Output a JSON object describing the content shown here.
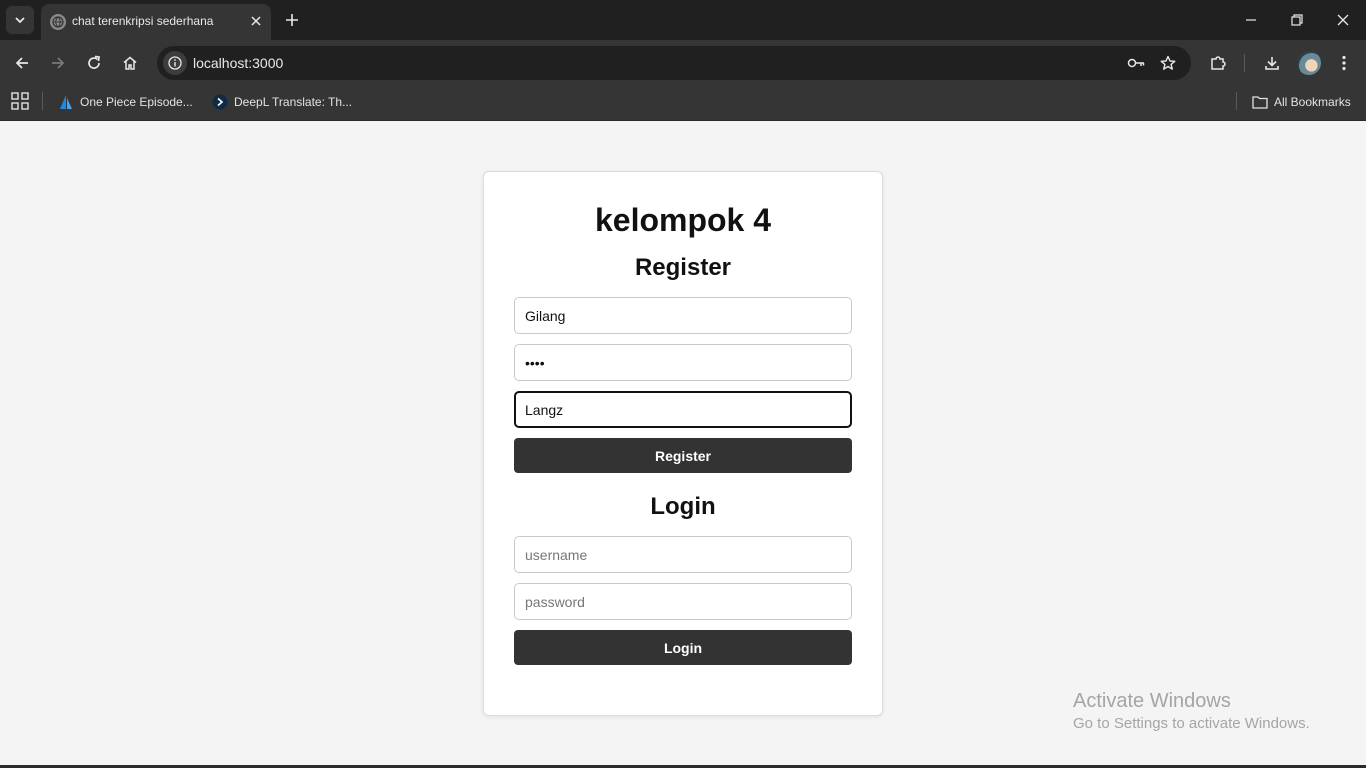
{
  "browser": {
    "tab": {
      "title": "chat terenkripsi sederhana"
    },
    "address": {
      "url": "localhost:3000"
    },
    "bookmarks": [
      {
        "label": "One Piece Episode..."
      },
      {
        "label": "DeepL Translate: Th..."
      }
    ],
    "all_bookmarks_label": "All Bookmarks"
  },
  "page": {
    "title": "kelompok 4",
    "register": {
      "heading": "Register",
      "username_value": "Gilang",
      "password_value": "••••",
      "third_value": "Langz",
      "button_label": "Register"
    },
    "login": {
      "heading": "Login",
      "username_placeholder": "username",
      "password_placeholder": "password",
      "button_label": "Login"
    }
  },
  "os": {
    "watermark_title": "Activate Windows",
    "watermark_subtitle": "Go to Settings to activate Windows."
  },
  "colors": {
    "button_bg": "#333333",
    "page_bg": "#f4f4f4",
    "chrome_dark": "#202020",
    "chrome_toolbar": "#353535"
  }
}
